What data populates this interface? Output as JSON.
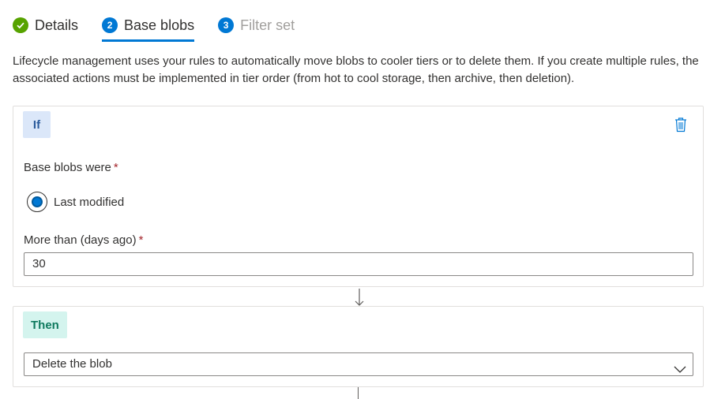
{
  "tabs": [
    {
      "step": "✓",
      "label": "Details",
      "state": "done"
    },
    {
      "step": "2",
      "label": "Base blobs",
      "state": "active"
    },
    {
      "step": "3",
      "label": "Filter set",
      "state": "todo"
    }
  ],
  "description": "Lifecycle management uses your rules to automatically move blobs to cooler tiers or to delete them. If you create multiple rules, the associated actions must be implemented in tier order (from hot to cool storage, then archive, then deletion).",
  "if_card": {
    "badge": "If",
    "base_blobs_label": "Base blobs were",
    "required_mark": "*",
    "radio_option": "Last modified",
    "radio_selected": true,
    "days_label": "More than (days ago)",
    "days_value": "30"
  },
  "then_card": {
    "badge": "Then",
    "action_selected": "Delete the blob"
  },
  "colors": {
    "accent": "#0078d4",
    "done": "#57a300",
    "required": "#a4262c",
    "if_badge_bg": "#dbe7f9",
    "then_badge_bg": "#d4f4ee"
  },
  "icons": {
    "delete": "trash-icon",
    "select": "chevron-down-icon",
    "flow": "arrow-down-icon"
  }
}
